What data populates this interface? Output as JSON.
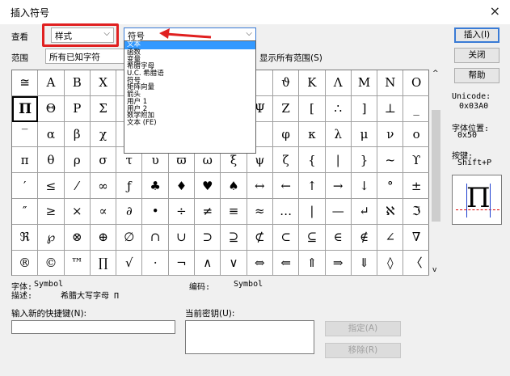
{
  "dialog": {
    "title": "插入符号",
    "close_glyph": "×"
  },
  "view": {
    "label": "查看",
    "value": "样式"
  },
  "font_combo": {
    "value": "符号"
  },
  "range": {
    "label": "范围",
    "value": "所有已知字符",
    "show_all": "显示所有范围(S)"
  },
  "dropdown_items": [
    "文本",
    "函数",
    "变量",
    "希腊字母",
    "U.C. 希腊语",
    "符号",
    "矩阵向量",
    "箭头",
    "用户 1",
    "用户 2",
    "数学附加",
    "文本 (FE)"
  ],
  "dropdown_selected_index": 0,
  "symbols": [
    [
      "≅",
      "A",
      "B",
      "X",
      "",
      "",
      "",
      "",
      "",
      "",
      "ϑ",
      "K",
      "Λ",
      "M",
      "N",
      "O"
    ],
    [
      "Π",
      "Θ",
      "P",
      "Σ",
      "",
      "",
      "",
      "",
      "",
      "Ψ",
      "Z",
      "[",
      "∴",
      "]",
      "⊥",
      "_"
    ],
    [
      "‾",
      "α",
      "β",
      "χ",
      "",
      "",
      "",
      "",
      "",
      "",
      "φ",
      "κ",
      "λ",
      "μ",
      "ν",
      "ο"
    ],
    [
      "π",
      "θ",
      "ρ",
      "σ",
      "τ",
      "υ",
      "ϖ",
      "ω",
      "ξ",
      "ψ",
      "ζ",
      "{",
      "|",
      "}",
      "~",
      "ϒ"
    ],
    [
      "′",
      "≤",
      "⁄",
      "∞",
      "ƒ",
      "♣",
      "♦",
      "♥",
      "♠",
      "↔",
      "←",
      "↑",
      "→",
      "↓",
      "°",
      "±"
    ],
    [
      "″",
      "≥",
      "×",
      "∝",
      "∂",
      "•",
      "÷",
      "≠",
      "≡",
      "≈",
      "…",
      "|",
      "—",
      "↵",
      "ℵ",
      "ℑ"
    ],
    [
      "ℜ",
      "℘",
      "⊗",
      "⊕",
      "∅",
      "∩",
      "∪",
      "⊃",
      "⊇",
      "⊄",
      "⊂",
      "⊆",
      "∈",
      "∉",
      "∠",
      "∇"
    ],
    [
      "®",
      "©",
      "™",
      "∏",
      "√",
      "⋅",
      "¬",
      "∧",
      "∨",
      "⇔",
      "⇐",
      "⇑",
      "⇒",
      "⇓",
      "◊",
      "〈"
    ]
  ],
  "selected_symbol": {
    "row": 1,
    "col": 0
  },
  "buttons": {
    "insert": "插入(I)",
    "close": "关闭",
    "help": "帮助"
  },
  "unicode": {
    "label": "Unicode:",
    "value": "0x03A0"
  },
  "char_pos": {
    "label": "字体位置:",
    "value": "0x50"
  },
  "keys": {
    "label": "按键:",
    "value": "Shift+P"
  },
  "preview_symbol": "Π",
  "info": {
    "font_label": "字体:",
    "font_value": "Symbol",
    "encoding_label": "编码:",
    "encoding_value": "Symbol",
    "desc_label": "描述:",
    "desc_value": "希腊大写字母 Π"
  },
  "shortcut": {
    "new_label": "输入新的快捷键(N):",
    "current_label": "当前密钥(U):",
    "assign": "指定(A)",
    "remove": "移除(R)"
  },
  "colors": {
    "highlight": "#3399ff",
    "annotation": "#e02020",
    "accent": "#3a7bd5"
  }
}
